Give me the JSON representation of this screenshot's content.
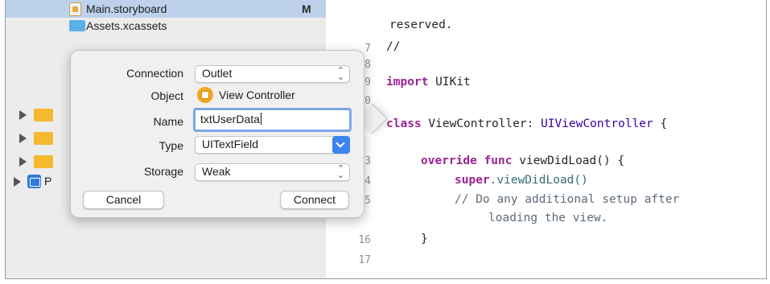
{
  "navigator": {
    "selected_file": {
      "label": "Main.storyboard",
      "badge": "M"
    },
    "assets": {
      "label": "Assets.xcassets"
    },
    "project_row_initial": "P"
  },
  "editor": {
    "lines": [
      {
        "num": "",
        "text": "    reserved."
      },
      {
        "num": "7",
        "text": "//"
      },
      {
        "num": "8",
        "text": ""
      },
      {
        "num": "9",
        "text": "import UIKit"
      },
      {
        "num": "0",
        "text": ""
      },
      {
        "num": "",
        "text": "class ViewController: UIViewController {"
      },
      {
        "num": "",
        "text": ""
      },
      {
        "num": "3",
        "text": "    override func viewDidLoad() {"
      },
      {
        "num": "4",
        "text": "        super.viewDidLoad()"
      },
      {
        "num": "5",
        "text": "        // Do any additional setup after"
      },
      {
        "num": "",
        "text": "            loading the view."
      },
      {
        "num": "16",
        "text": "    }"
      },
      {
        "num": "17",
        "text": ""
      }
    ],
    "tokens": {
      "import_kw": "import",
      "import_mod": "UIKit",
      "class_kw": "class",
      "class_name": "ViewController:",
      "superclass": "UIViewController",
      "brace": "{",
      "override_kw": "override",
      "func_kw": "func",
      "func_sig": "viewDidLoad() {",
      "super_kw": "super",
      "super_call": ".viewDidLoad()",
      "comment1": "// Do any additional setup after",
      "comment2": "loading the view.",
      "close_brace": "}",
      "reserved": "reserved.",
      "slashes": "//"
    }
  },
  "dialog": {
    "connection": {
      "label": "Connection",
      "value": "Outlet"
    },
    "object": {
      "label": "Object",
      "value": "View Controller"
    },
    "name": {
      "label": "Name",
      "value": "txtUserData"
    },
    "type": {
      "label": "Type",
      "value": "UITextField"
    },
    "storage": {
      "label": "Storage",
      "value": "Weak"
    },
    "cancel_label": "Cancel",
    "connect_label": "Connect"
  },
  "icons": [
    "storyboard-icon",
    "folder-icon",
    "disclosure-triangle-icon",
    "project-icon",
    "view-controller-icon",
    "stepper-icon",
    "chevron-down-icon"
  ],
  "colors": {
    "selection": "#bdd2ea",
    "keyword": "#9b2393",
    "type": "#3900a0",
    "focus_ring": "#7aa8e6",
    "accent": "#3d84f0"
  }
}
